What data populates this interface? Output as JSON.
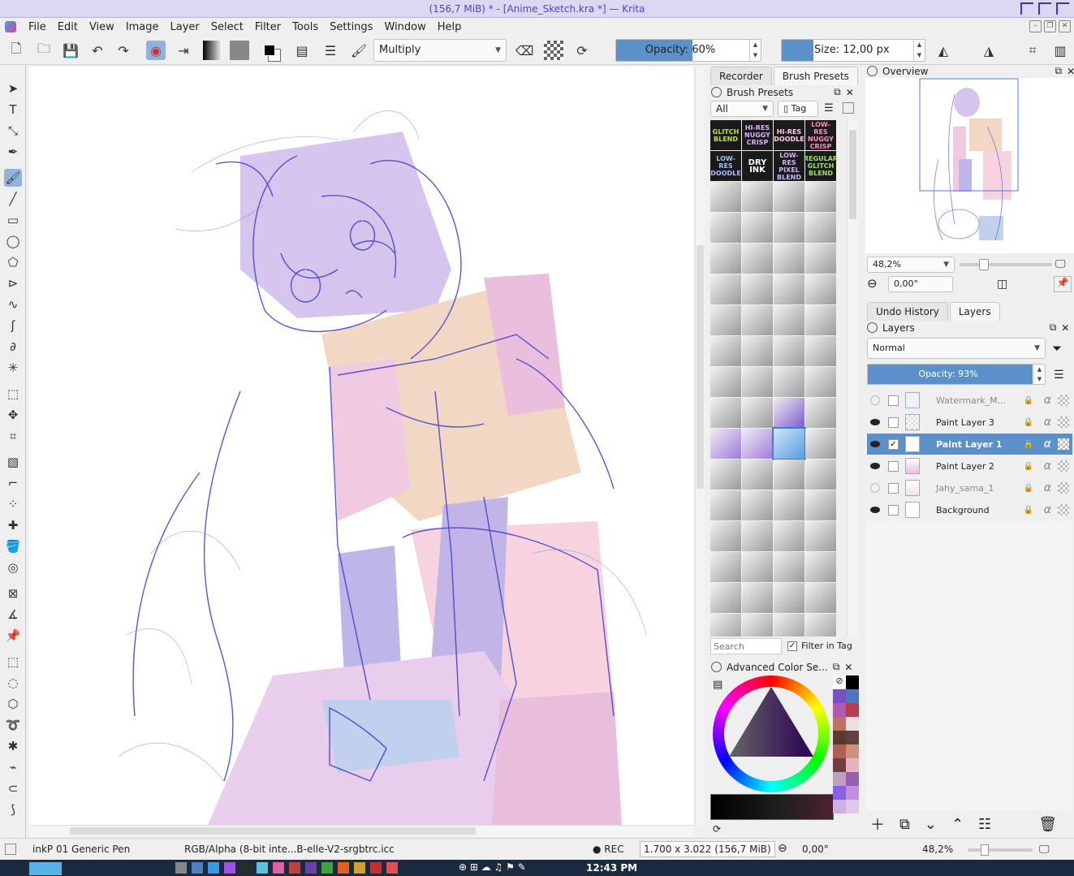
{
  "window": {
    "title": "(156,7 MiB)  * - [Anime_Sketch.kra *] — Krita"
  },
  "menu": [
    "File",
    "Edit",
    "View",
    "Image",
    "Layer",
    "Select",
    "Filter",
    "Tools",
    "Settings",
    "Window",
    "Help"
  ],
  "toolbar": {
    "blend_mode": "Multiply",
    "opacity_label": "Opacity:",
    "opacity_value": "60%",
    "size_label": "Size:",
    "size_value": "12,00 px",
    "opacity_fraction": 0.6
  },
  "dock_tabs": {
    "recorder": "Recorder",
    "brush_presets": "Brush Presets"
  },
  "brush_presets": {
    "title": "Brush Presets",
    "filter_all": "All",
    "tag_label": "Tag",
    "search_placeholder": "Search",
    "filter_in_tag": "Filter in Tag",
    "labeled_presets": [
      "GLITCH BLEND",
      "HI-RES NUGGY CRISP",
      "HI-RES DOODLE",
      "LOW-RES NUGGY CRISP",
      "LOW-RES DOODLE",
      "DRY INK",
      "LOW-RES PIXEL BLEND",
      "REGULAR GLITCH BLEND"
    ]
  },
  "color_selector": {
    "title": "Advanced Color Se..."
  },
  "overview": {
    "title": "Overview",
    "zoom": "48,2%",
    "rotation": "0,00°"
  },
  "layers_tabs": {
    "undo": "Undo History",
    "layers": "Layers"
  },
  "layers": {
    "title": "Layers",
    "blend": "Normal",
    "opacity_label": "Opacity:  93%",
    "opacity_fraction": 0.93,
    "items": [
      {
        "name": "Watermark_M...",
        "visible": false,
        "selected": false
      },
      {
        "name": "Paint Layer 3",
        "visible": true,
        "selected": false
      },
      {
        "name": "Paint Layer 1",
        "visible": true,
        "selected": true
      },
      {
        "name": "Paint Layer 2",
        "visible": true,
        "selected": false
      },
      {
        "name": "Jahy_sama_1",
        "visible": false,
        "selected": false
      },
      {
        "name": "Background",
        "visible": true,
        "selected": false
      }
    ]
  },
  "status": {
    "brush": "inkP 01 Generic Pen",
    "color": "RGB/Alpha (8-bit inte...B-elle-V2-srgbtrc.icc",
    "rec": "● REC",
    "dims": "1.700 x 3.022 (156,7 MiB)",
    "rotation": "0,00°",
    "zoom": "48,2%"
  },
  "taskbar": {
    "clock": "12:43 PM"
  }
}
